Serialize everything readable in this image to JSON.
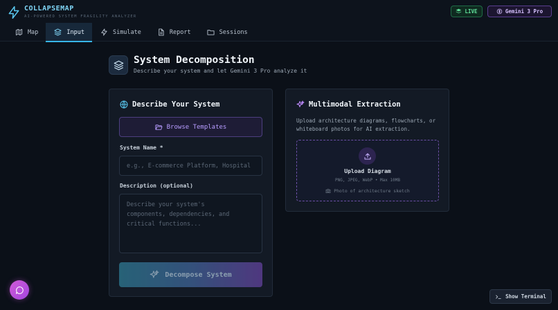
{
  "app": {
    "name": "COLLAPSEMAP",
    "tagline": "AI-POWERED SYSTEM FRAGILITY ANALYZER",
    "logo_icon": "lightning-icon",
    "accent": "#38b6e8"
  },
  "header": {
    "live_label": "LIVE",
    "model_label": "Gemini 3 Pro"
  },
  "tabs": [
    {
      "label": "Map",
      "icon": "map-icon",
      "active": false
    },
    {
      "label": "Input",
      "icon": "layers-icon",
      "active": true
    },
    {
      "label": "Simulate",
      "icon": "zap-icon",
      "active": false
    },
    {
      "label": "Report",
      "icon": "document-icon",
      "active": false
    },
    {
      "label": "Sessions",
      "icon": "folder-icon",
      "active": false
    }
  ],
  "page": {
    "title": "System Decomposition",
    "subtitle": "Describe your system and let Gemini 3 Pro analyze it"
  },
  "describe_panel": {
    "title": "Describe Your System",
    "browse_label": "Browse Templates",
    "name_label": "System Name *",
    "name_placeholder": "e.g., E-commerce Platform, Hospital",
    "name_value": "",
    "desc_label": "Description (optional)",
    "desc_placeholder": "Describe your system's\ncomponents, dependencies, and\ncritical functions...",
    "desc_value": "",
    "submit_label": "Decompose System"
  },
  "extract_panel": {
    "title": "Multimodal Extraction",
    "description": "Upload architecture diagrams, flowcharts, or whiteboard photos for AI extraction.",
    "upload_title": "Upload Diagram",
    "upload_formats": "PNG, JPEG, WebP • Max 10MB",
    "upload_hint": "Photo of architecture sketch"
  },
  "footer": {
    "terminal_label": "Show Terminal"
  },
  "colors": {
    "background": "#0b1018",
    "panel": "#131a25",
    "purple": "#b79cff",
    "live_green": "#5fe09a"
  }
}
